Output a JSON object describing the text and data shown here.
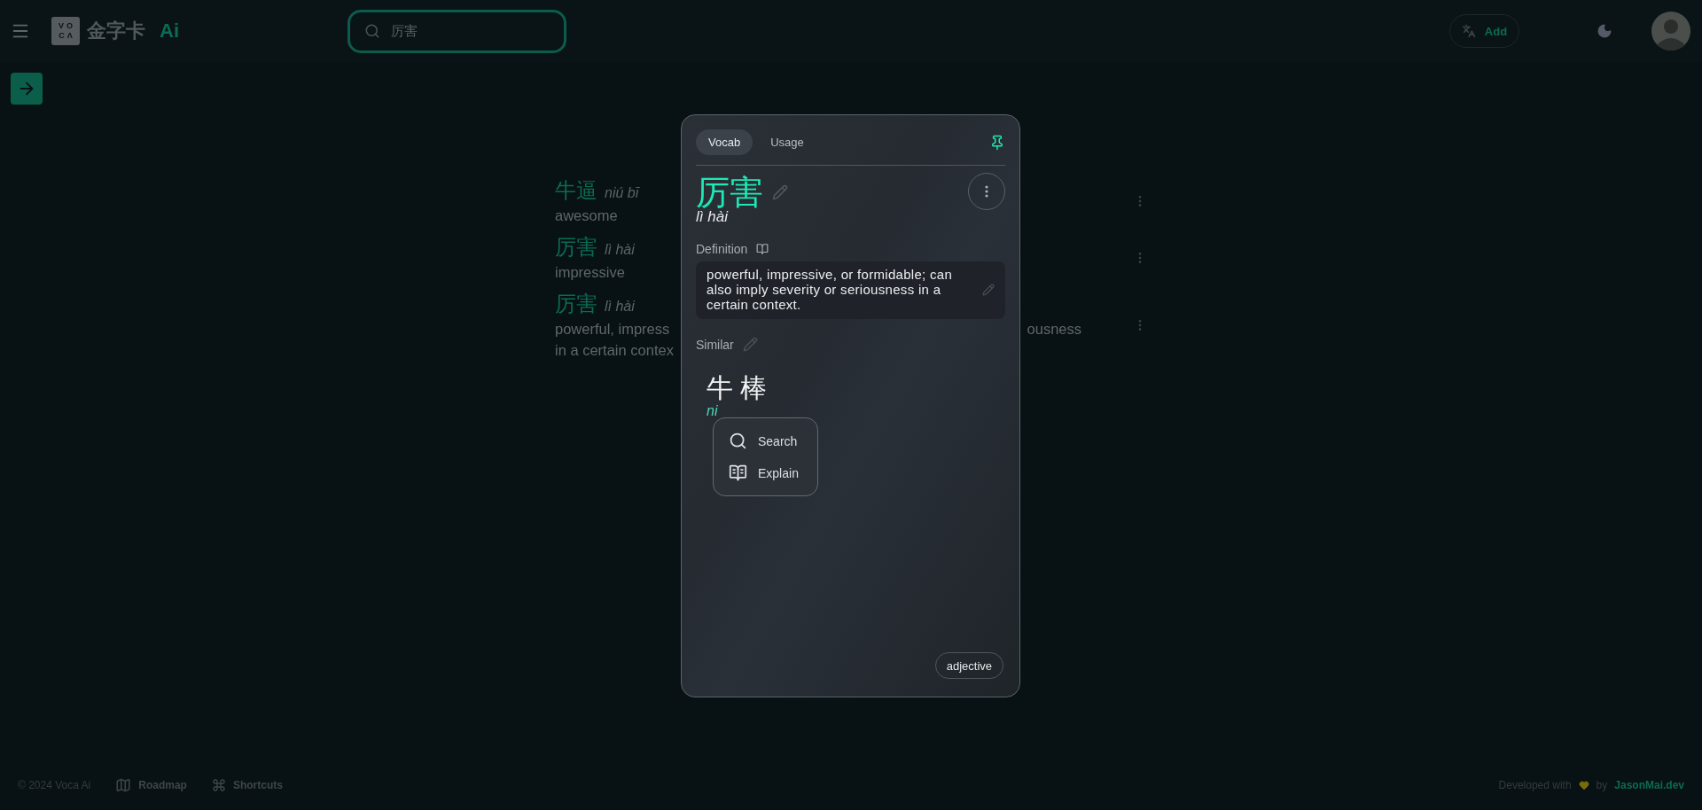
{
  "header": {
    "logo_letters": [
      "VO",
      "CΛ"
    ],
    "brand": "金字卡",
    "brand_suffix": "Ai",
    "search": {
      "value": "厉害"
    },
    "add_button": "Add"
  },
  "words": [
    {
      "kind": "plain",
      "hanzi": "牛逼",
      "pinyin": "niú bī",
      "meaning": "awesome"
    },
    {
      "kind": "plain",
      "hanzi": "厉害",
      "pinyin": "lì hài",
      "meaning": "impressive"
    },
    {
      "kind": "covered",
      "hanzi": "厉害",
      "pinyin": "lì hài",
      "meaning_left": [
        "powerful, impress",
        "in a certain contex"
      ],
      "meaning_right": "ousness"
    }
  ],
  "card": {
    "tabs": [
      {
        "label": "Vocab",
        "selected": true
      },
      {
        "label": "Usage",
        "selected": false
      }
    ],
    "pinned": true,
    "word": "厉害",
    "pinyin": "lì hài",
    "definition_label": "Definition",
    "definition": "powerful, impressive, or formidable; can also imply severity or seriousness in a certain context.",
    "similar_label": "Similar",
    "similar": {
      "hanzi": "牛 棒",
      "pinyin": "ni"
    },
    "menu": [
      {
        "kind": "search",
        "label": "Search"
      },
      {
        "kind": "book",
        "label": "Explain"
      }
    ],
    "part_of_speech": "adjective"
  },
  "footer": {
    "copyright": "© 2024 Voca Ai",
    "links": [
      {
        "kind": "map",
        "label": "Roadmap"
      },
      {
        "kind": "command",
        "label": "Shortcuts"
      }
    ],
    "credit_prefix": "Developed with",
    "credit_by": "by",
    "author": "JasonMai.dev"
  }
}
